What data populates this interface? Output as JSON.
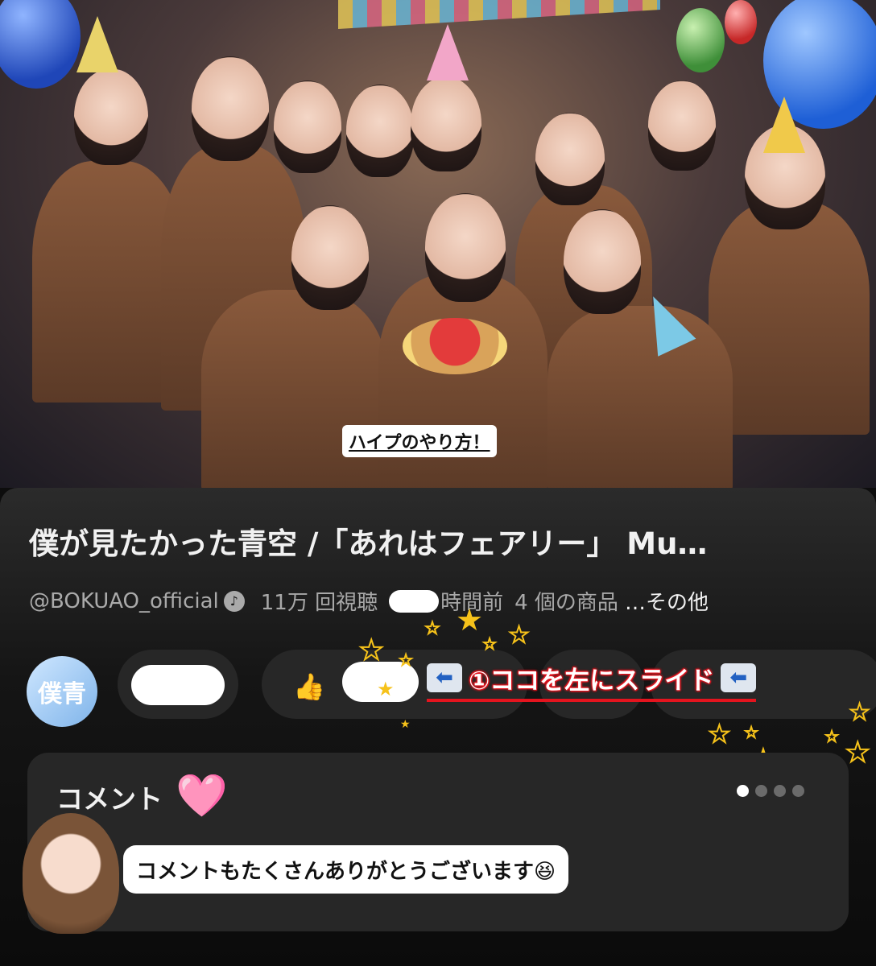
{
  "video": {
    "caption": "ハイプのやり方！"
  },
  "info": {
    "title": "僕が見たかった青空 /「あれはフェアリー」 Mu…",
    "channel": "@BOKUAO_official",
    "views": "11万 回視聴",
    "time_suffix": "時間前",
    "products": "4 個の商品",
    "more": "…その他"
  },
  "channel_avatar_text": "僕青",
  "actions": {
    "like_icon": "thumbs-up-icon",
    "slide_hint": "①ココを左にスライド"
  },
  "comments": {
    "title": "コメント",
    "heart": "🩷",
    "text": "コメントもたくさんありがとうございます😆"
  },
  "colors": {
    "accent_red": "#e4141e",
    "star": "#f6c21a",
    "heart": "#e553c8",
    "panel_bg": "#151515",
    "chip_bg": "#272727"
  }
}
